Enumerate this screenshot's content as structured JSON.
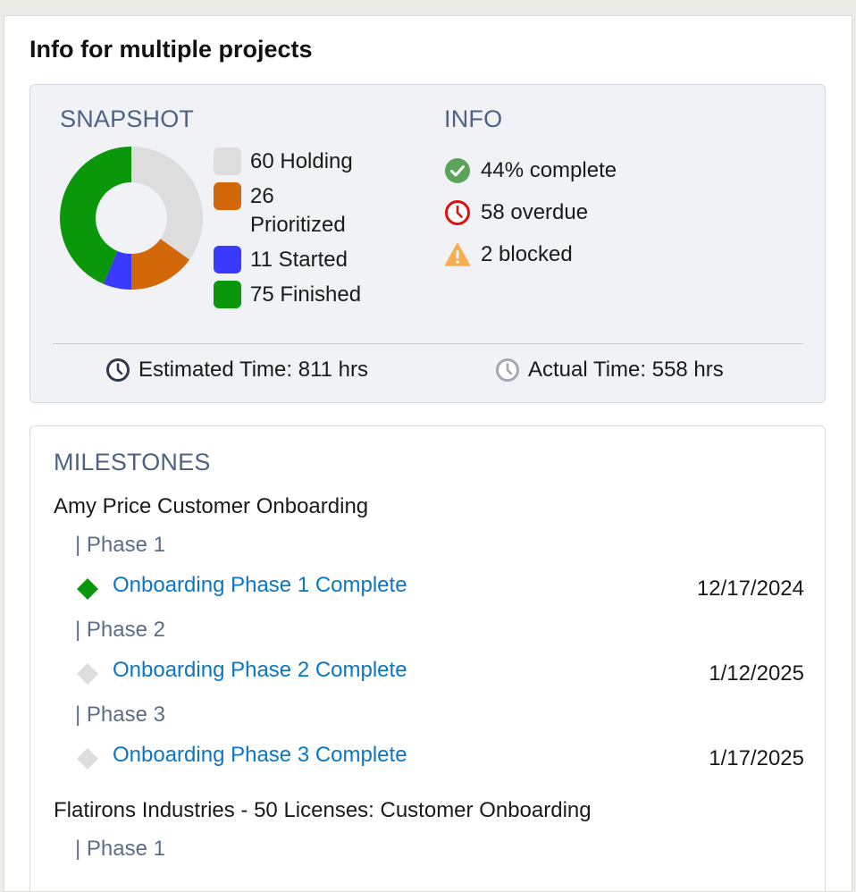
{
  "page": {
    "title": "Info for multiple projects"
  },
  "snapshot": {
    "heading": "SNAPSHOT",
    "segments": [
      {
        "count": 60,
        "label": "Holding",
        "text": "60 Holding",
        "color": "#dddddd"
      },
      {
        "count": 26,
        "label": "Prioritized",
        "text": "26 Prioritized",
        "color": "#d2680a"
      },
      {
        "count": 11,
        "label": "Started",
        "text": "11 Started",
        "color": "#3a3afc"
      },
      {
        "count": 75,
        "label": "Finished",
        "text": "75 Finished",
        "color": "#0a980a"
      }
    ]
  },
  "info": {
    "heading": "INFO",
    "complete": {
      "text": "44% complete",
      "icon": "check-circle-icon",
      "color": "#5ba35b"
    },
    "overdue": {
      "text": "58 overdue",
      "icon": "clock-icon",
      "color": "#e01010"
    },
    "blocked": {
      "text": "2 blocked",
      "icon": "warning-icon",
      "color": "#f7ae52"
    }
  },
  "times": {
    "estimated": "Estimated Time: 811 hrs",
    "actual": "Actual Time: 558 hrs"
  },
  "milestones": {
    "heading": "MILESTONES",
    "projects": [
      {
        "name": "Amy Price Customer Onboarding",
        "phases": [
          {
            "label": "| Phase 1",
            "milestone": "Onboarding Phase 1 Complete",
            "date": "12/17/2024",
            "status": "complete",
            "color": "#0a980a"
          },
          {
            "label": "| Phase 2",
            "milestone": "Onboarding Phase 2 Complete",
            "date": "1/12/2025",
            "status": "pending",
            "color": "#dddddd"
          },
          {
            "label": "| Phase 3",
            "milestone": "Onboarding Phase 3 Complete",
            "date": "1/17/2025",
            "status": "pending",
            "color": "#dddddd"
          }
        ]
      },
      {
        "name": "Flatirons Industries - 50 Licenses: Customer Onboarding",
        "phases": [
          {
            "label": "| Phase 1"
          }
        ]
      }
    ]
  }
}
